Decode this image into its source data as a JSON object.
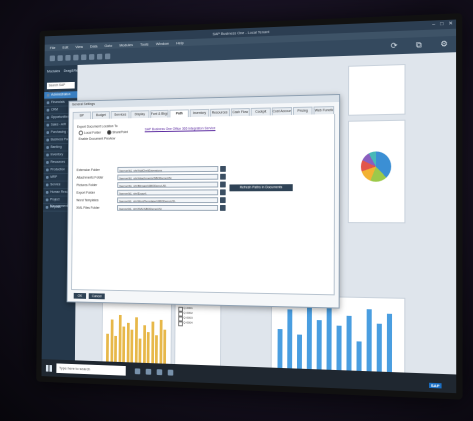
{
  "app": {
    "title": "SAP Business One - Local Tenant",
    "window_controls": [
      "–",
      "□",
      "✕"
    ],
    "menu": [
      "File",
      "Edit",
      "View",
      "Data",
      "Goto",
      "Modules",
      "Tools",
      "Window",
      "Help"
    ],
    "toolbar_right_icons": [
      "refresh-icon",
      "share-icon",
      "settings-icon"
    ]
  },
  "sidebar": {
    "header": [
      "Modules",
      "Drag&Relate"
    ],
    "search_placeholder": "Search SAP Business",
    "items": [
      {
        "label": "Administration",
        "active": true
      },
      {
        "label": "Financials",
        "active": false
      },
      {
        "label": "CRM",
        "active": false
      },
      {
        "label": "Opportunities",
        "active": false
      },
      {
        "label": "Sales - A/R",
        "active": false
      },
      {
        "label": "Purchasing - A/P",
        "active": false
      },
      {
        "label": "Business Partners",
        "active": false
      },
      {
        "label": "Banking",
        "active": false
      },
      {
        "label": "Inventory",
        "active": false
      },
      {
        "label": "Resources",
        "active": false
      },
      {
        "label": "Production",
        "active": false
      },
      {
        "label": "MRP",
        "active": false
      },
      {
        "label": "Service",
        "active": false
      },
      {
        "label": "Human Resources",
        "active": false
      },
      {
        "label": "Project Management",
        "active": false
      },
      {
        "label": "Reports",
        "active": false
      }
    ]
  },
  "dialog": {
    "title": "General Settings",
    "tabs": [
      {
        "label": "BP",
        "active": false
      },
      {
        "label": "Budget",
        "active": false
      },
      {
        "label": "Services",
        "active": false
      },
      {
        "label": "Display",
        "active": false
      },
      {
        "label": "Font & Bkgd",
        "active": false
      },
      {
        "label": "Path",
        "active": true
      },
      {
        "label": "Inventory",
        "active": false
      },
      {
        "label": "Resources",
        "active": false
      },
      {
        "label": "Cash Flow",
        "active": false
      },
      {
        "label": "Cockpit",
        "active": false
      },
      {
        "label": "Cost Accounting",
        "active": false
      },
      {
        "label": "Pricing",
        "active": false
      },
      {
        "label": "Web Functions",
        "active": false
      }
    ],
    "location_label": "Export Document Location To",
    "radio_local": "Local Folder",
    "radio_sharepoint": "SharePoint",
    "sharepoint_link": "SAP Business One Office 365 Integration Service",
    "enable_doc_label": "Enable Document Preview",
    "paths": [
      {
        "label": "Extension Folder",
        "value": "\\\\server\\b1_shr\\AddOns\\Extensions"
      },
      {
        "label": "Attachments Folder",
        "value": "\\\\server\\b1_shr\\Attachments\\SBODemoUS\\"
      },
      {
        "label": "Pictures Folder",
        "value": "\\\\server\\b1_shr\\Bitmaps\\SBODemoUS\\"
      },
      {
        "label": "Export Folder",
        "value": "\\\\server\\b1_shr\\Export\\"
      },
      {
        "label": "Word Templates",
        "value": "\\\\server\\b1_shr\\WordTemplates\\SBODemoUS\\"
      },
      {
        "label": "XML Files Folder",
        "value": "\\\\server\\b1_shr\\XML\\SBODemoUS\\"
      }
    ],
    "refresh_button": "Refresh Paths in Documents",
    "ok_button": "OK",
    "cancel_button": "Cancel"
  },
  "checklist": [
    "Q-0001",
    "Q-0002",
    "Q-0003",
    "Q-0004"
  ],
  "taskbar": {
    "search_placeholder": "Type here to search",
    "sap_logo": "SAP"
  },
  "colors": {
    "accent": "#3a7fc1",
    "toolbar": "#34495e",
    "pie": [
      "#3b8fd4",
      "#9cc94a",
      "#f2b233",
      "#e2564a",
      "#8a5fbf",
      "#47b8b8"
    ]
  }
}
